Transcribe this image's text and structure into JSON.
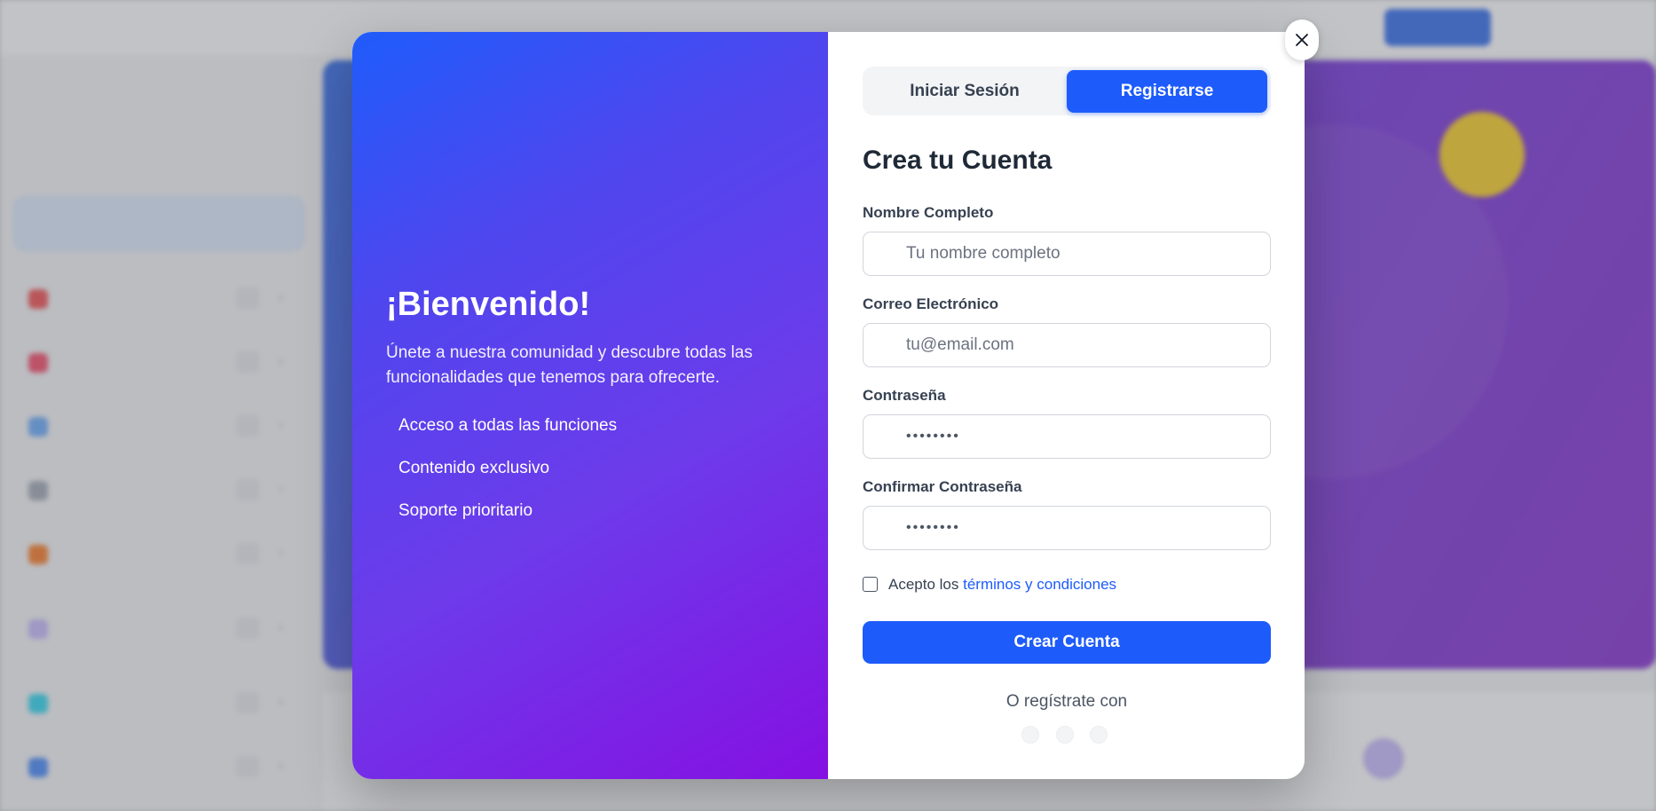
{
  "modal": {
    "welcome": {
      "title": "¡Bienvenido!",
      "text": "Únete a nuestra comunidad y descubre todas las funcionalidades que tenemos para ofrecerte.",
      "benefits": [
        "Acceso a todas las funciones",
        "Contenido exclusivo",
        "Soporte prioritario"
      ]
    },
    "tabs": {
      "login": "Iniciar Sesión",
      "register": "Registrarse",
      "active": "register"
    },
    "form": {
      "title": "Crea tu Cuenta",
      "full_name": {
        "label": "Nombre Completo",
        "placeholder": "Tu nombre completo",
        "icon": "user-icon"
      },
      "email": {
        "label": "Correo Electrónico",
        "placeholder": "tu@email.com",
        "icon": "mail-icon"
      },
      "password": {
        "label": "Contraseña",
        "placeholder": "••••••••",
        "icon": "lock-icon"
      },
      "confirm_password": {
        "label": "Confirmar Contraseña",
        "placeholder": "••••••••",
        "icon": "lock-icon"
      },
      "terms": {
        "prefix": "Acepto los ",
        "link": "términos y condiciones",
        "checked": false
      },
      "submit": "Crear Cuenta",
      "social_prompt": "O regístrate con",
      "social_count": 3
    },
    "close_icon": "close-icon"
  },
  "colors": {
    "primary": "#1d5bfb",
    "gradient_start": "#1f5cfb",
    "gradient_end": "#8510e2"
  }
}
